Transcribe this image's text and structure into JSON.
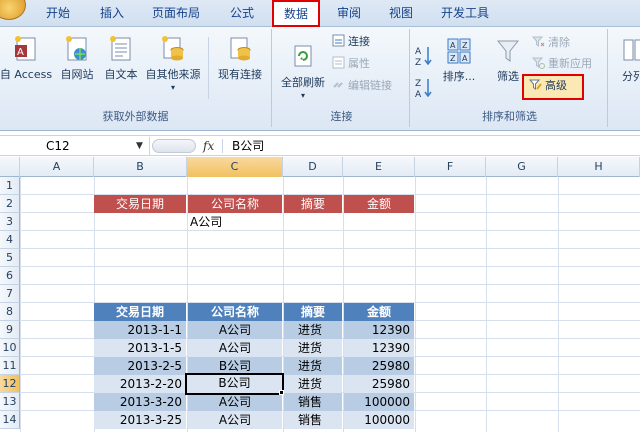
{
  "tabs": [
    {
      "label": "开始"
    },
    {
      "label": "插入"
    },
    {
      "label": "页面布局"
    },
    {
      "label": "公式"
    },
    {
      "label": "数据",
      "active": true
    },
    {
      "label": "审阅"
    },
    {
      "label": "视图"
    },
    {
      "label": "开发工具"
    }
  ],
  "ribbon": {
    "group_external": {
      "label": "获取外部数据",
      "buttons": [
        "自 Access",
        "自网站",
        "自文本",
        "自其他来源",
        "现有连接"
      ]
    },
    "group_connections": {
      "label": "连接",
      "refresh_all": "全部刷新",
      "connections": "连接",
      "properties": "属性",
      "edit_links": "编辑链接"
    },
    "group_sort_filter": {
      "label": "排序和筛选",
      "sort": "排序...",
      "filter": "筛选",
      "clear": "清除",
      "reapply": "重新应用",
      "advanced": "高级"
    },
    "group_tools": {
      "label_partial": "分列"
    }
  },
  "formula_bar": {
    "name_box": "C12",
    "fx": "fx",
    "content": "B公司"
  },
  "columns": [
    "A",
    "B",
    "C",
    "D",
    "E",
    "F",
    "G",
    "H"
  ],
  "selected_column": "C",
  "rows": [
    "1",
    "2",
    "3",
    "4",
    "5",
    "6",
    "7",
    "8",
    "9",
    "10",
    "11",
    "12",
    "13",
    "14"
  ],
  "selected_row": "12",
  "criteria_table": {
    "headers": [
      "交易日期",
      "公司名称",
      "摘要",
      "金额"
    ],
    "values": [
      "",
      "A公司",
      "",
      ""
    ]
  },
  "data_table": {
    "headers": [
      "交易日期",
      "公司名称",
      "摘要",
      "金额"
    ],
    "rows": [
      [
        "2013-1-1",
        "A公司",
        "进货",
        "12390"
      ],
      [
        "2013-1-5",
        "A公司",
        "进货",
        "12390"
      ],
      [
        "2013-2-5",
        "B公司",
        "进货",
        "25980"
      ],
      [
        "2013-2-20",
        "B公司",
        "进货",
        "25980"
      ],
      [
        "2013-3-20",
        "A公司",
        "销售",
        "100000"
      ],
      [
        "2013-3-25",
        "A公司",
        "销售",
        "100000"
      ]
    ]
  },
  "colors": {
    "criteria_header": "#c0504d",
    "data_header": "#4f81bd",
    "band_dark": "#b8cce4",
    "band_light": "#dbe5f1",
    "highlight_outline": "#e00000"
  }
}
